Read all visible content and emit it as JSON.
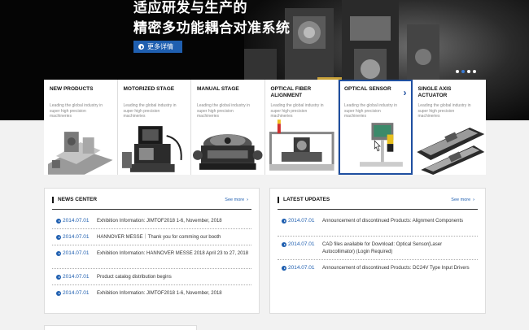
{
  "hero": {
    "title_line1": "适应研发与生产的",
    "title_line2": "精密多功能耦合对准系统",
    "button_label": "更多详情",
    "slides": 4,
    "active_slide": 2
  },
  "products": [
    {
      "title": "NEW PRODUCTS",
      "desc": "Leading the global industry in super high precision machineries",
      "icon": "new-products"
    },
    {
      "title": "MOTORIZED STAGE",
      "desc": "Leading the global industry in super high precision machineries",
      "icon": "motorized-stage"
    },
    {
      "title": "MANUAL STAGE",
      "desc": "Leading the global industry in super high precision machineries",
      "icon": "manual-stage"
    },
    {
      "title": "OPTICAL FIBER ALIGNMENT",
      "desc": "Leading the global industry in super high precision machineries",
      "icon": "optical-fiber-alignment"
    },
    {
      "title": "OPTICAL SENSOR",
      "desc": "Leading the global industry in super high precision machineries",
      "icon": "optical-sensor",
      "active": true
    },
    {
      "title": "SINGLE AXIS ACTUATOR",
      "desc": "Leading the global industry in super high precision machineries",
      "icon": "single-axis-actuator"
    }
  ],
  "news": {
    "title": "NEWS CENTER",
    "see_more": "See more",
    "items": [
      {
        "date": "2014.07.01",
        "text": "Exhibition Information: JIMTOF2018 1-6, November, 2018"
      },
      {
        "date": "2014.07.01",
        "text": "HANNOVER MESSE｜Thank you for comming our booth"
      },
      {
        "date": "2014.07.01",
        "text": "Exhibition Information: HANNOVER MESSE 2018 April 23 to 27, 2018"
      },
      {
        "date": "2014.07.01",
        "text": "Product catalog distribution begins"
      },
      {
        "date": "2014.07.01",
        "text": "Exhibition Information: JIMTOF2018 1-6, November, 2018"
      }
    ]
  },
  "updates": {
    "title": "LATEST UPDATES",
    "see_more": "See more",
    "items": [
      {
        "date": "2014.07.01",
        "text": "Announcement of discontinued Products: Alignment Components"
      },
      {
        "date": "2014.07.01",
        "text": "CAD files available for Download: Optical Sensor(Laser Autocollimator) (Login Required)"
      },
      {
        "date": "2014.07.01",
        "text": "Announcement of discontinued Products: DC24V Type Input Drivers"
      }
    ]
  },
  "colors": {
    "accent": "#1f5fb0",
    "active_border": "#1f4fa0"
  }
}
